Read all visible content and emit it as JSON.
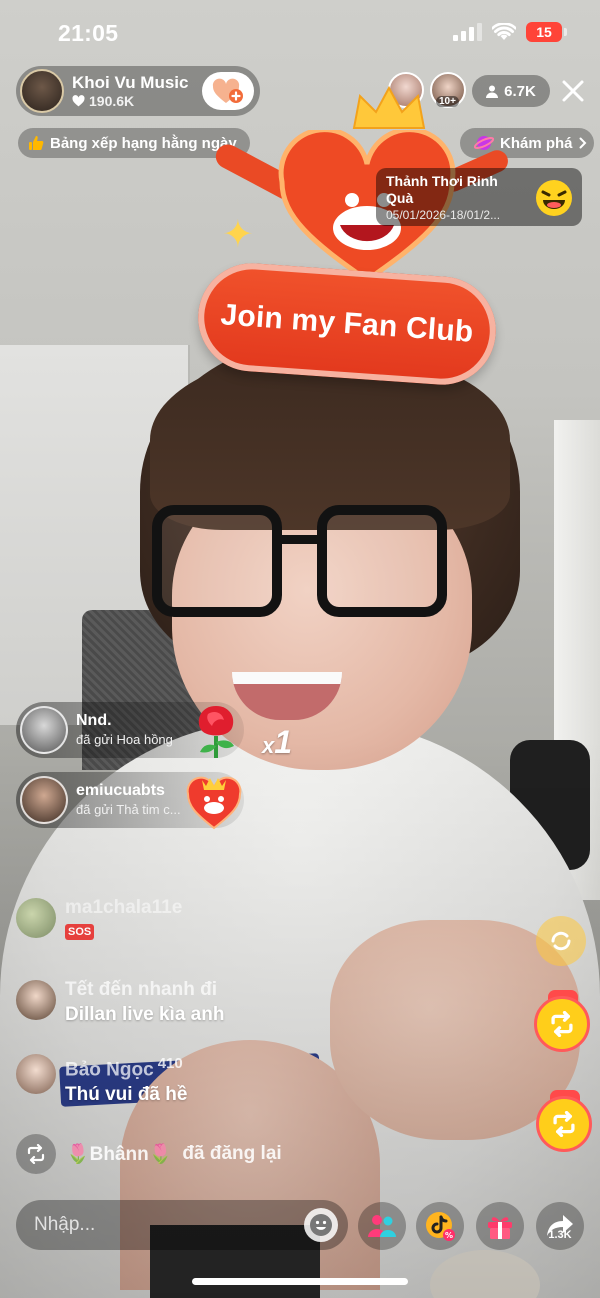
{
  "status_bar": {
    "time": "21:05",
    "battery": "15",
    "battery_color": "#ff4438"
  },
  "host": {
    "name": "Khoi Vu Music",
    "likes": "190.6K"
  },
  "top_right": {
    "viewer_badge": "10+",
    "viewer_count": "6.7K"
  },
  "ranking": {
    "label": "Bảng xếp hạng hằng ngày"
  },
  "explore": {
    "label": "Khám phá"
  },
  "promo": {
    "title": "Thảnh Thơi Rinh Quà",
    "dates": "05/01/2026-18/01/2..."
  },
  "fan_club": {
    "label": "Join my Fan Club",
    "accent": "#e2381d"
  },
  "gifts": [
    {
      "user": "Nnd.",
      "action": "đã gửi Hoa hồng",
      "gift_icon": "rose-icon",
      "count": "1",
      "count_prefix": "x"
    },
    {
      "user": "emiucuabts",
      "action": "đã gửi Thả tim c...",
      "gift_icon": "heart-gift-icon"
    }
  ],
  "chat": [
    {
      "user": "ma1chala11e",
      "message": "SOS"
    },
    {
      "user": "Tết đến nhanh đi",
      "message": "Dillan live kìa anh"
    },
    {
      "user": "Bảo Ngọc",
      "level": "410",
      "message": "Thú vui đã hề"
    }
  ],
  "repost": {
    "user": "🌷Bhânn🌷",
    "action": "đã đăng lại"
  },
  "bottom_bar": {
    "placeholder": "Nhập...",
    "share_count": "1.3K"
  },
  "colors": {
    "live_bg": "#9a9a96",
    "repost_yellow": "#ffce1a",
    "gift_red": "#ff4a4a"
  }
}
